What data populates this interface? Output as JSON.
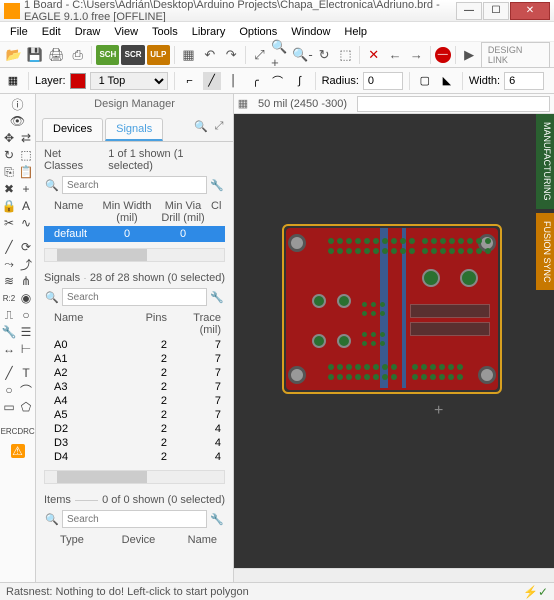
{
  "title": "1 Board - C:\\Users\\Adrián\\Desktop\\Arduino Projects\\Chapa_Electronica\\Adriuno.brd - EAGLE 9.1.0 free [OFFLINE]",
  "menu": [
    "File",
    "Edit",
    "Draw",
    "View",
    "Tools",
    "Library",
    "Options",
    "Window",
    "Help"
  ],
  "toolbar": {
    "sch": "SCH",
    "scr": "SCR",
    "ulp": "ULP",
    "design_link": "DESIGN LINK"
  },
  "layer": {
    "label": "Layer:",
    "value": "1 Top",
    "radius_label": "Radius:",
    "radius": "0",
    "width_label": "Width:",
    "width": "6"
  },
  "panel": {
    "title": "Design Manager",
    "tabs": {
      "devices": "Devices",
      "signals": "Signals"
    },
    "search_placeholder": "Search",
    "netclasses": {
      "title": "Net Classes",
      "status": "1 of 1 shown (1 selected)",
      "cols": {
        "name": "Name",
        "mw": "Min Width (mil)",
        "md": "Min Via Drill (mil)",
        "cl": "Cl"
      },
      "row": {
        "name": "default",
        "mw": "0",
        "md": "0"
      }
    },
    "signals": {
      "title": "Signals",
      "status": "28 of 28 shown (0 selected)",
      "cols": {
        "name": "Name",
        "pins": "Pins",
        "trace": "Trace (mil)"
      },
      "rows": [
        {
          "n": "A0",
          "p": "2",
          "t": "7"
        },
        {
          "n": "A1",
          "p": "2",
          "t": "7"
        },
        {
          "n": "A2",
          "p": "2",
          "t": "7"
        },
        {
          "n": "A3",
          "p": "2",
          "t": "7"
        },
        {
          "n": "A4",
          "p": "2",
          "t": "7"
        },
        {
          "n": "A5",
          "p": "2",
          "t": "7"
        },
        {
          "n": "D2",
          "p": "2",
          "t": "4"
        },
        {
          "n": "D3",
          "p": "2",
          "t": "4"
        },
        {
          "n": "D4",
          "p": "2",
          "t": "4"
        }
      ]
    },
    "items": {
      "title": "Items",
      "status": "0 of 0 shown (0 selected)",
      "cols": {
        "type": "Type",
        "device": "Device",
        "name": "Name"
      }
    }
  },
  "canvas": {
    "grid": "50 mil",
    "coord": "(2450 -300)",
    "cmd": ""
  },
  "right": {
    "mfg": "MANUFACTURING",
    "fusion": "FUSION SYNC"
  },
  "status": "Ratsnest: Nothing to do! Left-click to start polygon"
}
